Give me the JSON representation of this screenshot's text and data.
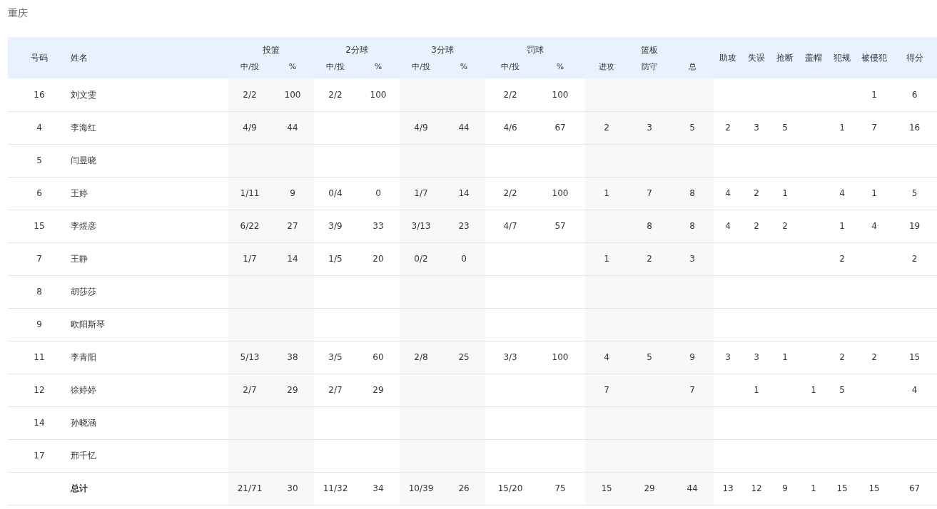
{
  "title": "重庆",
  "header": {
    "number": "号码",
    "name": "姓名",
    "columns": [
      {
        "label": "投篮",
        "sub": [
          "中/投",
          "%"
        ]
      },
      {
        "label": "2分球",
        "sub": [
          "中/投",
          "%"
        ]
      },
      {
        "label": "3分球",
        "sub": [
          "中/投",
          "%"
        ]
      },
      {
        "label": "罚球",
        "sub": [
          "中/投",
          "%"
        ]
      },
      {
        "label": "篮板",
        "sub": [
          "进攻",
          "防守",
          "总"
        ]
      },
      {
        "label": "助攻"
      },
      {
        "label": "失误"
      },
      {
        "label": "抢断"
      },
      {
        "label": "盖帽"
      },
      {
        "label": "犯规"
      },
      {
        "label": "被侵犯"
      },
      {
        "label": "得分"
      }
    ]
  },
  "rows": [
    {
      "kind": "player",
      "number": "16",
      "name": "刘文雯",
      "stats": {
        "fg": "2/2",
        "fg_pct": "100",
        "fg2": "2/2",
        "fg2_pct": "100",
        "ft": "2/2",
        "ft_pct": "100",
        "fouled": "1",
        "points": "6"
      }
    },
    {
      "kind": "player",
      "number": "4",
      "name": "李海红",
      "stats": {
        "fg": "4/9",
        "fg_pct": "44",
        "fg3": "4/9",
        "fg3_pct": "44",
        "ft": "4/6",
        "ft_pct": "67",
        "off_reb": "2",
        "def_reb": "3",
        "reb": "5",
        "ast": "2",
        "tov": "3",
        "stl": "5",
        "pf": "1",
        "fouled": "7",
        "points": "16"
      }
    },
    {
      "kind": "player",
      "number": "5",
      "name": "闫昱晓"
    },
    {
      "kind": "player",
      "number": "6",
      "name": "王婷",
      "stats": {
        "fg": "1/11",
        "fg_pct": "9",
        "fg2": "0/4",
        "fg2_pct": "0",
        "fg3": "1/7",
        "fg3_pct": "14",
        "ft": "2/2",
        "ft_pct": "100",
        "off_reb": "1",
        "def_reb": "7",
        "reb": "8",
        "ast": "4",
        "tov": "2",
        "stl": "1",
        "pf": "4",
        "fouled": "1",
        "points": "5"
      }
    },
    {
      "kind": "player",
      "number": "15",
      "name": "李煜彦",
      "stats": {
        "fg": "6/22",
        "fg_pct": "27",
        "fg2": "3/9",
        "fg2_pct": "33",
        "fg3": "3/13",
        "fg3_pct": "23",
        "ft": "4/7",
        "ft_pct": "57",
        "def_reb": "8",
        "reb": "8",
        "ast": "4",
        "tov": "2",
        "stl": "2",
        "pf": "1",
        "fouled": "4",
        "points": "19"
      }
    },
    {
      "kind": "player",
      "number": "7",
      "name": "王静",
      "stats": {
        "fg": "1/7",
        "fg_pct": "14",
        "fg2": "1/5",
        "fg2_pct": "20",
        "fg3": "0/2",
        "fg3_pct": "0",
        "off_reb": "1",
        "def_reb": "2",
        "reb": "3",
        "pf": "2",
        "points": "2"
      }
    },
    {
      "kind": "player",
      "number": "8",
      "name": "胡莎莎"
    },
    {
      "kind": "player",
      "number": "9",
      "name": "欧阳斯琴"
    },
    {
      "kind": "player",
      "number": "11",
      "name": "李青阳",
      "stats": {
        "fg": "5/13",
        "fg_pct": "38",
        "fg2": "3/5",
        "fg2_pct": "60",
        "fg3": "2/8",
        "fg3_pct": "25",
        "ft": "3/3",
        "ft_pct": "100",
        "off_reb": "4",
        "def_reb": "5",
        "reb": "9",
        "ast": "3",
        "tov": "3",
        "stl": "1",
        "pf": "2",
        "fouled": "2",
        "points": "15"
      }
    },
    {
      "kind": "player",
      "number": "12",
      "name": "徐婷婷",
      "stats": {
        "fg": "2/7",
        "fg_pct": "29",
        "fg2": "2/7",
        "fg2_pct": "29",
        "off_reb": "7",
        "reb": "7",
        "tov": "1",
        "blk": "1",
        "pf": "5",
        "points": "4"
      }
    },
    {
      "kind": "player",
      "number": "14",
      "name": "孙晓涵"
    },
    {
      "kind": "player",
      "number": "17",
      "name": "邢千忆"
    },
    {
      "kind": "total",
      "name": "总计",
      "stats": {
        "fg": "21/71",
        "fg_pct": "30",
        "fg2": "11/32",
        "fg2_pct": "34",
        "fg3": "10/39",
        "fg3_pct": "26",
        "ft": "15/20",
        "ft_pct": "75",
        "off_reb": "15",
        "def_reb": "29",
        "reb": "44",
        "ast": "13",
        "tov": "12",
        "stl": "9",
        "blk": "1",
        "pf": "15",
        "fouled": "15",
        "points": "67"
      }
    }
  ]
}
